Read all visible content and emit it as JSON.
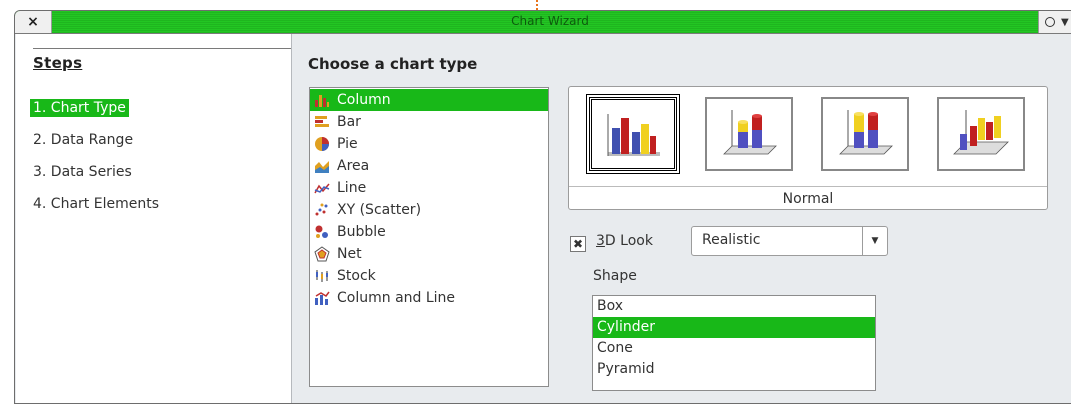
{
  "window": {
    "title": "Chart Wizard",
    "close_glyph": "×"
  },
  "steps": {
    "heading": "Steps",
    "items": [
      "1. Chart Type",
      "2. Data Range",
      "3. Data Series",
      "4. Chart Elements"
    ]
  },
  "main": {
    "heading": "Choose a chart type",
    "chart_types": [
      "Column",
      "Bar",
      "Pie",
      "Area",
      "Line",
      "XY (Scatter)",
      "Bubble",
      "Net",
      "Stock",
      "Column and Line"
    ],
    "selected_type": "Column",
    "variant_name": "Normal",
    "look3d": {
      "label_prefix": "3",
      "label_rest": "D Look",
      "checked": true,
      "value": "Realistic"
    },
    "shape_label": "Shape",
    "shapes": [
      "Box",
      "Cylinder",
      "Cone",
      "Pyramid"
    ],
    "selected_shape": "Cylinder"
  },
  "colors": {
    "accent": "#18b818",
    "titlebar": "#23c623"
  }
}
